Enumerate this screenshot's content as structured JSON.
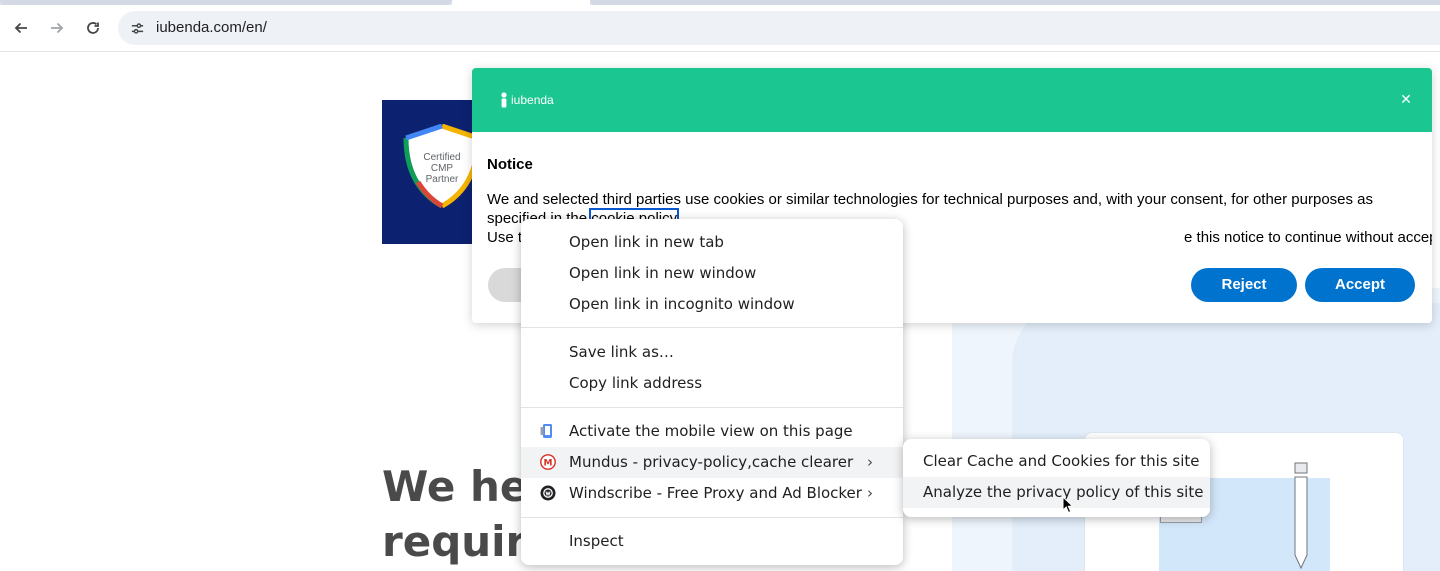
{
  "browser": {
    "url": "iubenda.com/en/",
    "back_icon": "arrow-left-icon",
    "forward_icon": "arrow-right-icon",
    "reload_icon": "reload-icon",
    "site_info_icon": "tune-icon"
  },
  "page": {
    "badge_line1": "Certified",
    "badge_line2": "CMP",
    "badge_line3": "Partner",
    "hero_line1": "We hel",
    "hero_line2": "require"
  },
  "cookie_banner": {
    "brand": "iubenda",
    "close_icon": "close-icon",
    "title": "Notice",
    "body_prefix": "We and selected third parties use cookies or similar technologies for technical purposes and, with your consent, for other purposes as specified in the ",
    "policy_link": "cookie policy",
    "body_line2_start": "Use t",
    "body_line2_end": "e this notice to continue without accepting.",
    "reject_label": "Reject",
    "accept_label": "Accept",
    "accent_color": "#1cc691",
    "button_color": "#0073ce"
  },
  "context_menu": {
    "items": [
      {
        "label": "Open link in new tab"
      },
      {
        "label": "Open link in new window"
      },
      {
        "label": "Open link in incognito window"
      },
      {
        "label": "Save link as…"
      },
      {
        "label": "Copy link address"
      },
      {
        "label": "Activate the mobile view on this page",
        "icon": "mobile-phone-icon"
      },
      {
        "label": "Mundus - privacy-policy,cache clearer",
        "icon": "mundus-logo-icon",
        "submenu": true
      },
      {
        "label": "Windscribe - Free Proxy and Ad Blocker",
        "icon": "windscribe-logo-icon",
        "submenu": true
      },
      {
        "label": "Inspect"
      }
    ],
    "submenu_items": [
      {
        "label": "Clear Cache and Cookies for this site"
      },
      {
        "label": "Analyze the privacy policy of this site"
      }
    ]
  }
}
